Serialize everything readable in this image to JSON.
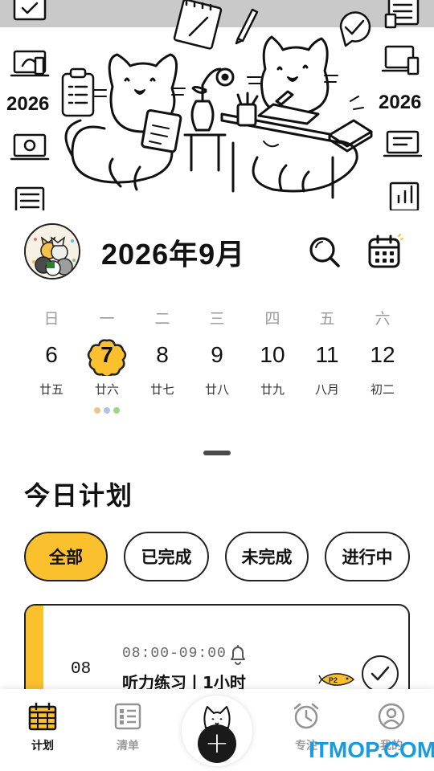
{
  "hero": {
    "year_left": "2026",
    "year_right": "2026"
  },
  "header": {
    "month_title": "2026年9月",
    "icons": [
      "avatar",
      "search-icon",
      "calendar-icon"
    ]
  },
  "week": {
    "days": [
      {
        "weekday": "日",
        "day": "6",
        "lunar": "廿五"
      },
      {
        "weekday": "一",
        "day": "7",
        "lunar": "廿六",
        "selected": true,
        "dot_colors": [
          "#e8c88a",
          "#a9c6e8",
          "#9bd68b"
        ]
      },
      {
        "weekday": "二",
        "day": "8",
        "lunar": "廿七"
      },
      {
        "weekday": "三",
        "day": "9",
        "lunar": "廿八"
      },
      {
        "weekday": "四",
        "day": "10",
        "lunar": "廿九"
      },
      {
        "weekday": "五",
        "day": "11",
        "lunar": "八月"
      },
      {
        "weekday": "六",
        "day": "12",
        "lunar": "初二"
      }
    ]
  },
  "plan": {
    "title": "今日计划",
    "filters": [
      {
        "label": "全部",
        "active": true
      },
      {
        "label": "已完成",
        "active": false
      },
      {
        "label": "未完成",
        "active": false
      },
      {
        "label": "进行中",
        "active": false
      }
    ],
    "task": {
      "day": "08",
      "time": "08:00-09:00",
      "title": "听力练习丨1小时",
      "priority": "P2",
      "accent_color": "#fbc02d"
    }
  },
  "bottom_nav": {
    "items": [
      {
        "label": "计划",
        "icon": "calendar-grid-icon",
        "active": true
      },
      {
        "label": "清单",
        "icon": "checklist-icon",
        "active": false
      },
      {
        "label": "专注",
        "icon": "alarm-clock-icon",
        "active": false
      },
      {
        "label": "我的",
        "icon": "user-icon",
        "active": false
      }
    ],
    "fab_symbol": "+"
  },
  "watermark": "ITMOP.COM",
  "colors": {
    "accent": "#fbc02d",
    "text": "#111111",
    "muted": "#9a9a9a"
  }
}
